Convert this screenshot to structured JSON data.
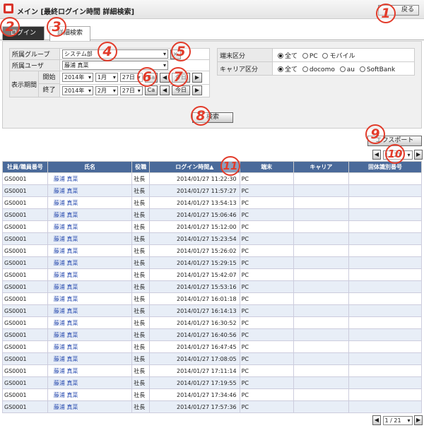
{
  "header": {
    "title": "メイン [最終ログイン時間 詳細検索]",
    "back_label": "戻る"
  },
  "tabs": [
    "ログイン",
    "詳細検索"
  ],
  "form": {
    "group_label": "所属グループ",
    "group_value": "システム部",
    "user_label": "所属ユーザ",
    "user_value": "藤浦 真菜",
    "period_label": "表示期間",
    "start_label": "開始",
    "end_label": "終了",
    "start": {
      "year": "2014年",
      "month": "1月",
      "day": "27日"
    },
    "end": {
      "year": "2014年",
      "month": "2月",
      "day": "27日"
    },
    "cal_label": "Ca",
    "today_label": "今日",
    "prev": "◀",
    "next": "▶",
    "terminal_label": "端末区分",
    "terminal_options": [
      "全て",
      "PC",
      "モバイル"
    ],
    "carrier_label": "キャリア区分",
    "carrier_options": [
      "全て",
      "docomo",
      "au",
      "SoftBank"
    ],
    "search_label": "検索",
    "export_label": "エクスポート"
  },
  "pager": {
    "value": "1 / 21"
  },
  "table": {
    "columns": [
      "社員/職員番号",
      "氏名",
      "役職",
      "ログイン時間▲",
      "端末",
      "キャリア",
      "固体識別番号"
    ],
    "rows": [
      [
        "GS0001",
        "藤浦 真菜",
        "社長",
        "2014/01/27 11:22:30",
        "PC"
      ],
      [
        "GS0001",
        "藤浦 真菜",
        "社長",
        "2014/01/27 11:57:27",
        "PC"
      ],
      [
        "GS0001",
        "藤浦 真菜",
        "社長",
        "2014/01/27 13:54:13",
        "PC"
      ],
      [
        "GS0001",
        "藤浦 真菜",
        "社長",
        "2014/01/27 15:06:46",
        "PC"
      ],
      [
        "GS0001",
        "藤浦 真菜",
        "社長",
        "2014/01/27 15:12:00",
        "PC"
      ],
      [
        "GS0001",
        "藤浦 真菜",
        "社長",
        "2014/01/27 15:23:54",
        "PC"
      ],
      [
        "GS0001",
        "藤浦 真菜",
        "社長",
        "2014/01/27 15:26:02",
        "PC"
      ],
      [
        "GS0001",
        "藤浦 真菜",
        "社長",
        "2014/01/27 15:29:15",
        "PC"
      ],
      [
        "GS0001",
        "藤浦 真菜",
        "社長",
        "2014/01/27 15:42:07",
        "PC"
      ],
      [
        "GS0001",
        "藤浦 真菜",
        "社長",
        "2014/01/27 15:53:16",
        "PC"
      ],
      [
        "GS0001",
        "藤浦 真菜",
        "社長",
        "2014/01/27 16:01:18",
        "PC"
      ],
      [
        "GS0001",
        "藤浦 真菜",
        "社長",
        "2014/01/27 16:14:13",
        "PC"
      ],
      [
        "GS0001",
        "藤浦 真菜",
        "社長",
        "2014/01/27 16:30:52",
        "PC"
      ],
      [
        "GS0001",
        "藤浦 真菜",
        "社長",
        "2014/01/27 16:40:56",
        "PC"
      ],
      [
        "GS0001",
        "藤浦 真菜",
        "社長",
        "2014/01/27 16:47:45",
        "PC"
      ],
      [
        "GS0001",
        "藤浦 真菜",
        "社長",
        "2014/01/27 17:08:05",
        "PC"
      ],
      [
        "GS0001",
        "藤浦 真菜",
        "社長",
        "2014/01/27 17:11:14",
        "PC"
      ],
      [
        "GS0001",
        "藤浦 真菜",
        "社長",
        "2014/01/27 17:19:55",
        "PC"
      ],
      [
        "GS0001",
        "藤浦 真菜",
        "社長",
        "2014/01/27 17:34:46",
        "PC"
      ],
      [
        "GS0001",
        "藤浦 真菜",
        "社長",
        "2014/01/27 17:57:36",
        "PC"
      ]
    ]
  },
  "badges": [
    "1",
    "2",
    "3",
    "4",
    "5",
    "6",
    "7",
    "8",
    "9",
    "10",
    "11"
  ],
  "accent_color": "#e23b2a"
}
